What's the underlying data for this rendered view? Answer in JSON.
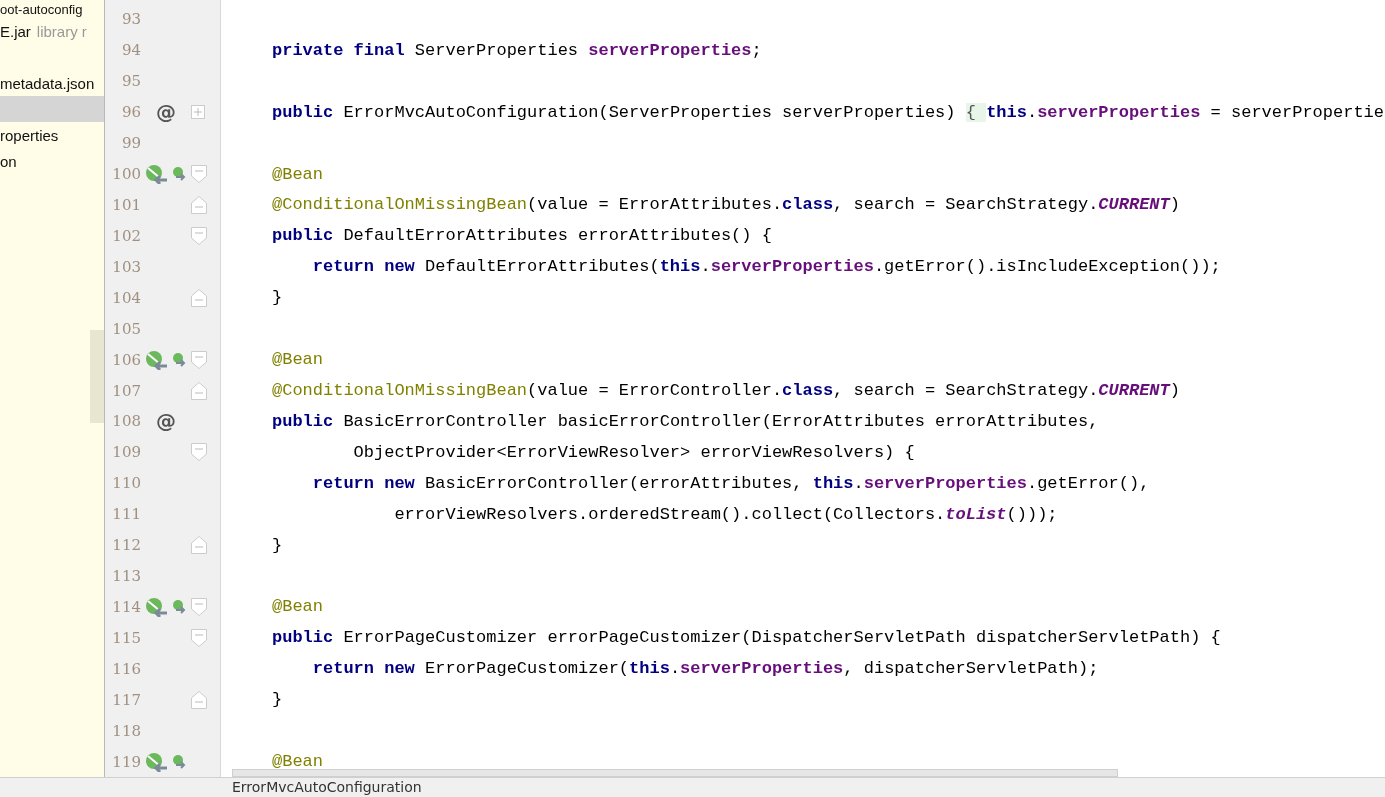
{
  "project_tree": {
    "items": [
      {
        "text": "oot-autoconfig",
        "selected": false
      },
      {
        "text": "E.jar",
        "hint": "library r",
        "selected": false
      },
      {
        "selected": false
      },
      {
        "text": "metadata.json",
        "selected": false
      },
      {
        "selected": true
      },
      {
        "text": "roperties",
        "selected": false
      },
      {
        "text": "on",
        "selected": false
      }
    ]
  },
  "editor": {
    "lines": [
      {
        "number": "93"
      },
      {
        "number": "94",
        "tokens": [
          {
            "kind": "kw",
            "text": "private final "
          },
          {
            "kind": "plain",
            "text": "ServerProperties "
          },
          {
            "kind": "field",
            "text": "serverProperties"
          },
          {
            "kind": "plain",
            "text": ";"
          }
        ]
      },
      {
        "number": "95"
      },
      {
        "number": "96",
        "fold": {
          "kind": "plus"
        },
        "mark": {
          "kind": "at",
          "text": "@"
        },
        "tokens": [
          {
            "kind": "kw",
            "text": "public "
          },
          {
            "kind": "plain",
            "text": "ErrorMvcAutoConfiguration(ServerProperties serverProperties) "
          },
          {
            "kind": "folded",
            "text": "{ "
          },
          {
            "kind": "kw",
            "text": "this"
          },
          {
            "kind": "plain",
            "text": "."
          },
          {
            "kind": "field",
            "text": "serverProperties"
          },
          {
            "kind": "plain",
            "text": " = serverPropertie"
          }
        ]
      },
      {
        "number": "99"
      },
      {
        "number": "100",
        "fold": {
          "kind": "open"
        },
        "mark": {
          "kind": "bean"
        },
        "tokens": [
          {
            "kind": "ann",
            "text": "@Bean"
          }
        ]
      },
      {
        "number": "101",
        "fold": {
          "kind": "close"
        },
        "tokens": [
          {
            "kind": "ann",
            "text": "@ConditionalOnMissingBean"
          },
          {
            "kind": "plain",
            "text": "(value = ErrorAttributes."
          },
          {
            "kind": "kw",
            "text": "class"
          },
          {
            "kind": "plain",
            "text": ", search = SearchStrategy."
          },
          {
            "kind": "static",
            "text": "CURRENT"
          },
          {
            "kind": "plain",
            "text": ")"
          }
        ]
      },
      {
        "number": "102",
        "fold": {
          "kind": "open"
        },
        "tokens": [
          {
            "kind": "kw",
            "text": "public "
          },
          {
            "kind": "plain",
            "text": "DefaultErrorAttributes errorAttributes() {"
          }
        ]
      },
      {
        "number": "103",
        "tokens": [
          {
            "kind": "kw",
            "text": "    return new "
          },
          {
            "kind": "plain",
            "text": "DefaultErrorAttributes("
          },
          {
            "kind": "kw",
            "text": "this"
          },
          {
            "kind": "plain",
            "text": "."
          },
          {
            "kind": "field",
            "text": "serverProperties"
          },
          {
            "kind": "plain",
            "text": ".getError().isIncludeException());"
          }
        ]
      },
      {
        "number": "104",
        "fold": {
          "kind": "close"
        },
        "tokens": [
          {
            "kind": "plain",
            "text": "}"
          }
        ]
      },
      {
        "number": "105"
      },
      {
        "number": "106",
        "fold": {
          "kind": "open"
        },
        "mark": {
          "kind": "bean"
        },
        "tokens": [
          {
            "kind": "ann",
            "text": "@Bean"
          }
        ]
      },
      {
        "number": "107",
        "fold": {
          "kind": "close"
        },
        "tokens": [
          {
            "kind": "ann",
            "text": "@ConditionalOnMissingBean"
          },
          {
            "kind": "plain",
            "text": "(value = ErrorController."
          },
          {
            "kind": "kw",
            "text": "class"
          },
          {
            "kind": "plain",
            "text": ", search = SearchStrategy."
          },
          {
            "kind": "static",
            "text": "CURRENT"
          },
          {
            "kind": "plain",
            "text": ")"
          }
        ]
      },
      {
        "number": "108",
        "mark": {
          "kind": "at",
          "text": "@"
        },
        "tokens": [
          {
            "kind": "kw",
            "text": "public "
          },
          {
            "kind": "plain",
            "text": "BasicErrorController basicErrorController(ErrorAttributes errorAttributes,"
          }
        ]
      },
      {
        "number": "109",
        "fold": {
          "kind": "open"
        },
        "tokens": [
          {
            "kind": "plain",
            "text": "        ObjectProvider<ErrorViewResolver> errorViewResolvers) {"
          }
        ]
      },
      {
        "number": "110",
        "tokens": [
          {
            "kind": "kw",
            "text": "    return new "
          },
          {
            "kind": "plain",
            "text": "BasicErrorController(errorAttributes, "
          },
          {
            "kind": "kw",
            "text": "this"
          },
          {
            "kind": "plain",
            "text": "."
          },
          {
            "kind": "field",
            "text": "serverProperties"
          },
          {
            "kind": "plain",
            "text": ".getError(),"
          }
        ]
      },
      {
        "number": "111",
        "tokens": [
          {
            "kind": "plain",
            "text": "            errorViewResolvers.orderedStream().collect(Collectors."
          },
          {
            "kind": "static",
            "text": "toList"
          },
          {
            "kind": "plain",
            "text": "()));"
          }
        ]
      },
      {
        "number": "112",
        "fold": {
          "kind": "close"
        },
        "tokens": [
          {
            "kind": "plain",
            "text": "}"
          }
        ]
      },
      {
        "number": "113"
      },
      {
        "number": "114",
        "fold": {
          "kind": "open"
        },
        "mark": {
          "kind": "bean"
        },
        "tokens": [
          {
            "kind": "ann",
            "text": "@Bean"
          }
        ]
      },
      {
        "number": "115",
        "fold": {
          "kind": "open"
        },
        "tokens": [
          {
            "kind": "kw",
            "text": "public "
          },
          {
            "kind": "plain",
            "text": "ErrorPageCustomizer errorPageCustomizer(DispatcherServletPath dispatcherServletPath) {"
          }
        ]
      },
      {
        "number": "116",
        "tokens": [
          {
            "kind": "kw",
            "text": "    return new "
          },
          {
            "kind": "plain",
            "text": "ErrorPageCustomizer("
          },
          {
            "kind": "kw",
            "text": "this"
          },
          {
            "kind": "plain",
            "text": "."
          },
          {
            "kind": "field",
            "text": "serverProperties"
          },
          {
            "kind": "plain",
            "text": ", dispatcherServletPath);"
          }
        ]
      },
      {
        "number": "117",
        "fold": {
          "kind": "close"
        },
        "tokens": [
          {
            "kind": "plain",
            "text": "}"
          }
        ]
      },
      {
        "number": "118"
      },
      {
        "number": "119",
        "mark": {
          "kind": "bean"
        },
        "tokens": [
          {
            "kind": "ann",
            "text": "@Bean"
          }
        ]
      }
    ]
  },
  "breadcrumb": "ErrorMvcAutoConfiguration"
}
